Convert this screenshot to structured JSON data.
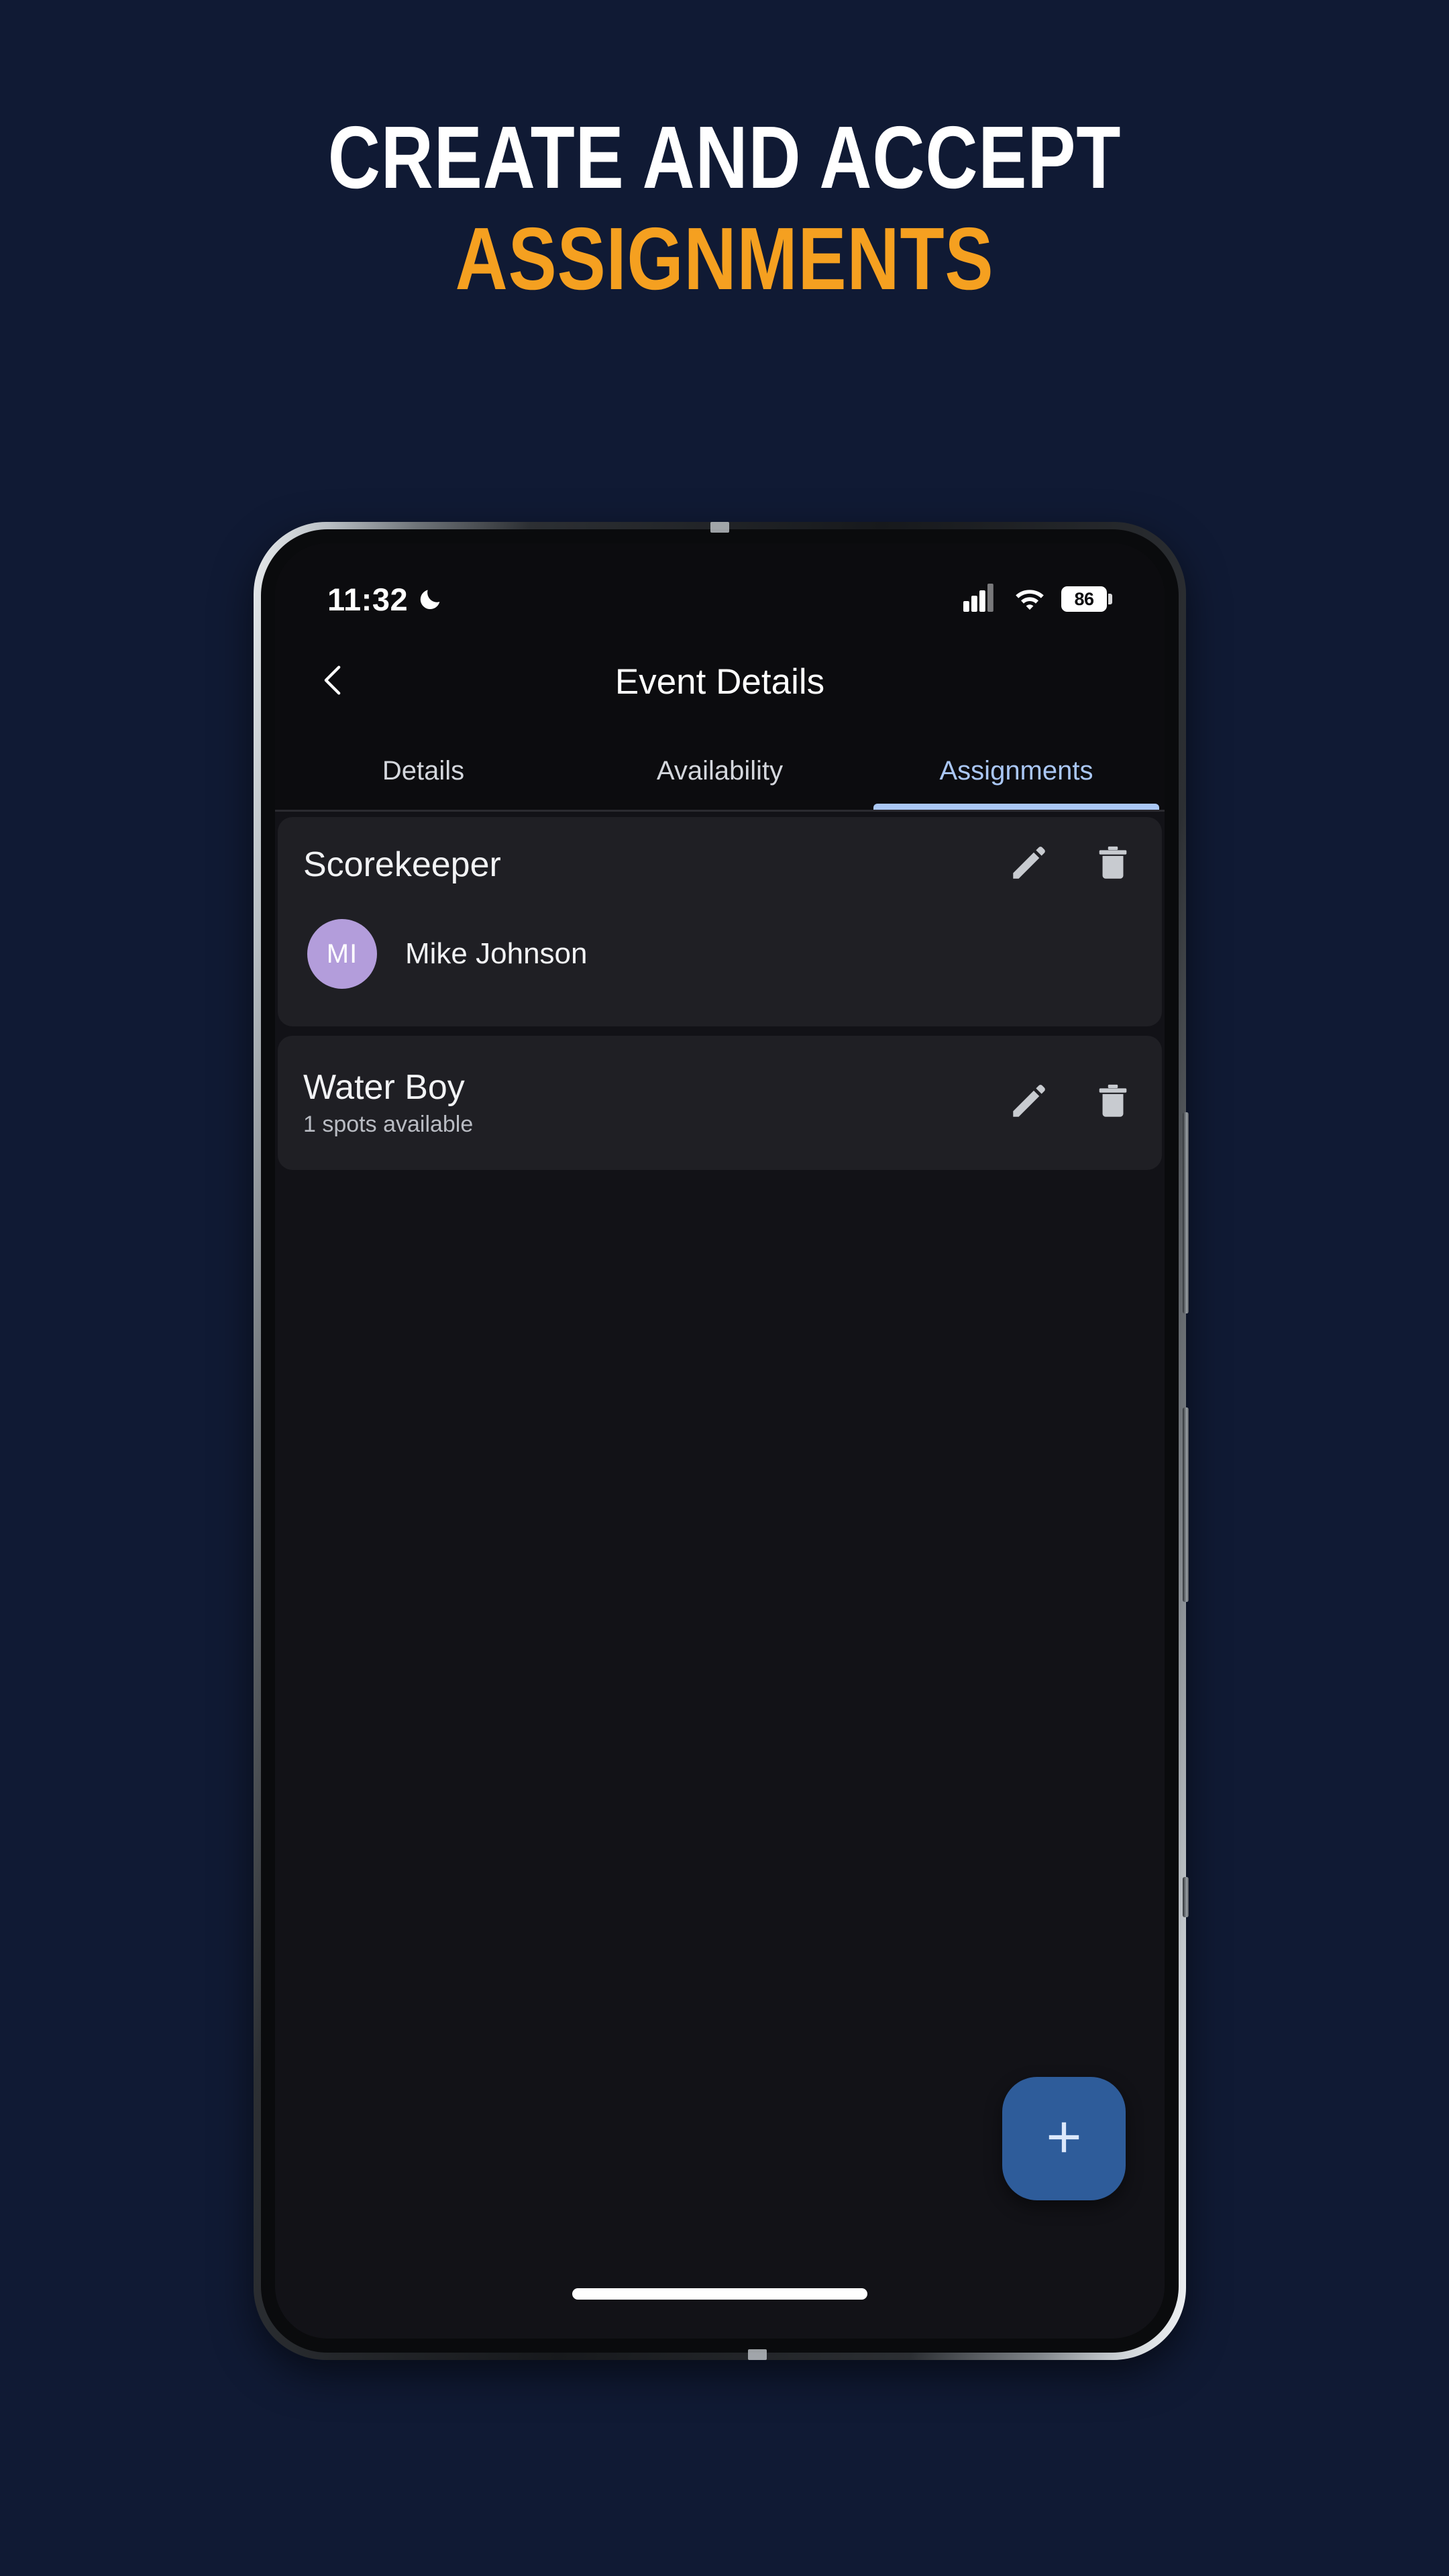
{
  "poster": {
    "background_color": "#101a34",
    "headline_line1": "CREATE AND ACCEPT",
    "headline_line2": "ASSIGNMENTS",
    "headline_line1_color": "#ffffff",
    "headline_line2_color": "#f5a020"
  },
  "status_bar": {
    "time": "11:32",
    "dnd_icon": "moon-icon",
    "signal_icon": "cellular-signal-icon",
    "wifi_icon": "wifi-icon",
    "battery_level": "86"
  },
  "app_bar": {
    "back_icon": "chevron-left-icon",
    "title": "Event Details"
  },
  "tabs": [
    {
      "label": "Details",
      "active": false
    },
    {
      "label": "Availability",
      "active": false
    },
    {
      "label": "Assignments",
      "active": true
    }
  ],
  "tab_active_color": "#aac7f5",
  "assignments": [
    {
      "title": "Scorekeeper",
      "subtitle": "",
      "edit_icon": "pencil-icon",
      "delete_icon": "trash-icon",
      "assignee": {
        "initials": "MI",
        "name": "Mike Johnson",
        "avatar_color": "#b39ddb"
      }
    },
    {
      "title": "Water Boy",
      "subtitle": "1 spots available",
      "edit_icon": "pencil-icon",
      "delete_icon": "trash-icon",
      "assignee": null
    }
  ],
  "fab": {
    "icon": "plus-icon",
    "color": "#2e5c9a"
  }
}
